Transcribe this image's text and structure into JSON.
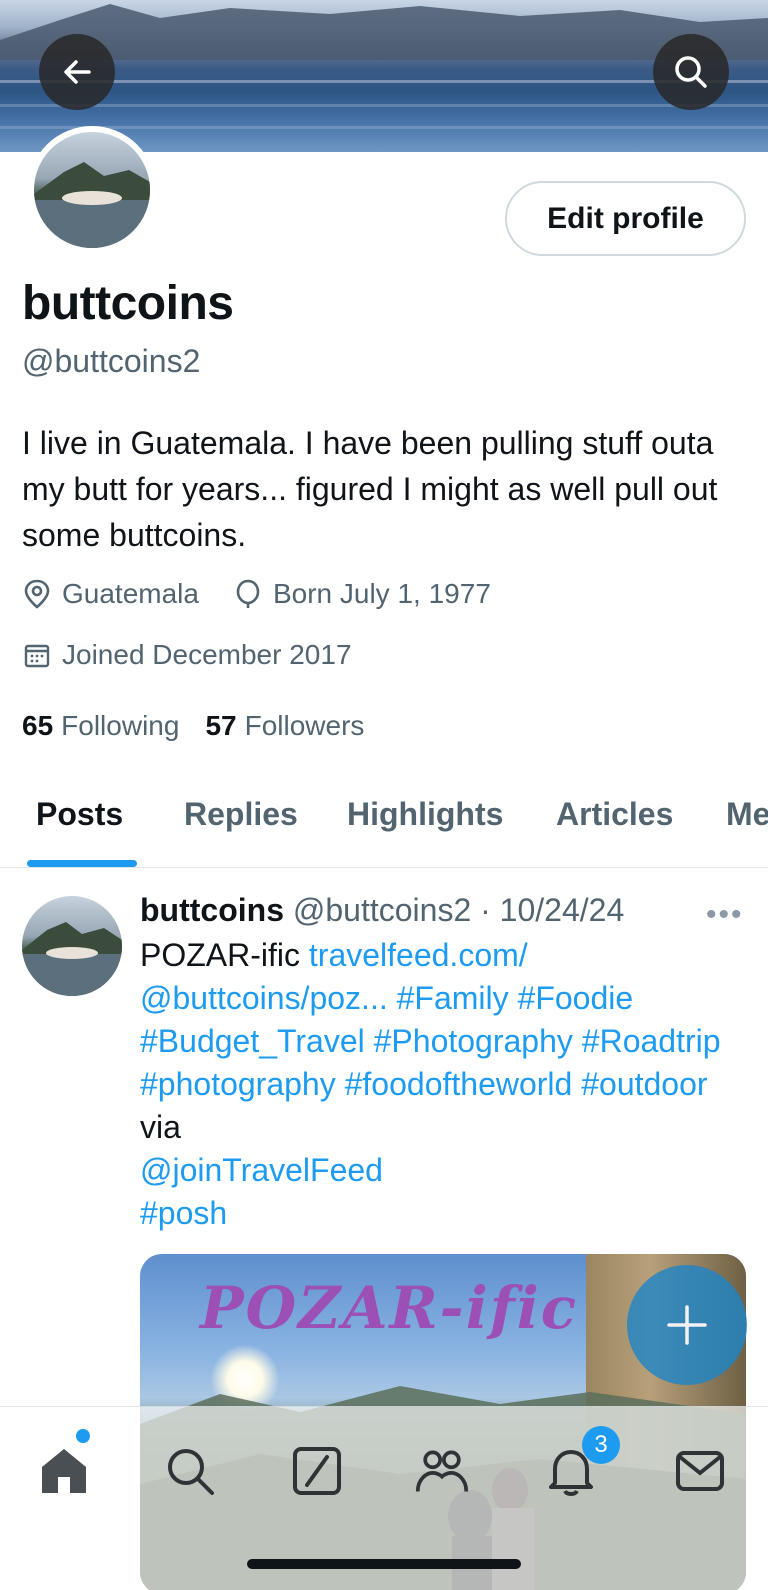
{
  "profile": {
    "name": "buttcoins",
    "handle": "@buttcoins2",
    "bio": "I live in Guatemala. I have been pulling stuff outa my butt for years... figured I might as well pull out some buttcoins.",
    "location": "Guatemala",
    "birthday": "Born July 1, 1977",
    "joined": "Joined December 2017",
    "following_count": "65",
    "following_label": "Following",
    "followers_count": "57",
    "followers_label": "Followers",
    "edit_label": "Edit profile"
  },
  "tabs": [
    "Posts",
    "Replies",
    "Highlights",
    "Articles",
    "Me"
  ],
  "post": {
    "name": "buttcoins",
    "handle": "@buttcoins2",
    "date": "10/24/24",
    "text_plain_1": "POZAR-ific ",
    "link_1": "travelfeed.com/ @buttcoins/poz...",
    "tags_1": "#Family #Foodie #Budget_Travel #Photography #Roadtrip #photography #foodoftheworld #outdoor",
    "text_plain_2": "via",
    "mention": "@joinTravelFeed",
    "tag_last": "#posh",
    "media_title": "POZAR-ific"
  },
  "notifications_badge": "3",
  "colors": {
    "accent": "#1d9bf0",
    "text": "#0f1419",
    "muted": "#536471"
  }
}
